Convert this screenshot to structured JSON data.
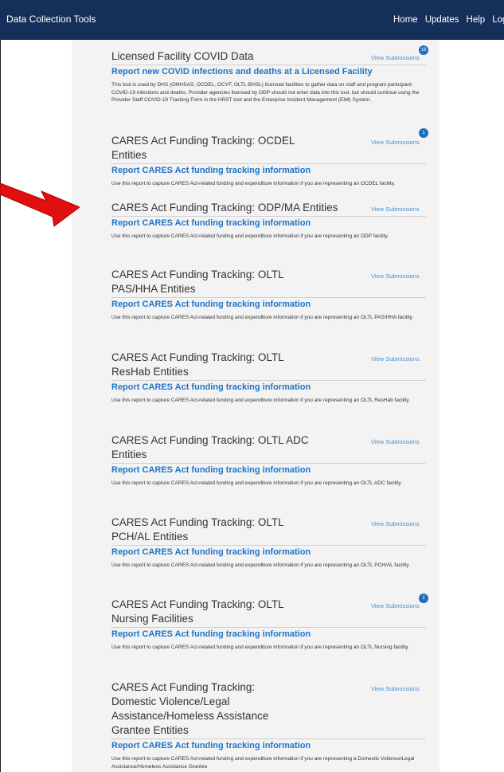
{
  "header": {
    "brand": "Data Collection Tools",
    "nav": [
      "Home",
      "Updates",
      "Help",
      "Logout"
    ]
  },
  "cards": [
    {
      "title": "Licensed Facility COVID Data",
      "view": "View Submissions",
      "badge": "18",
      "link": "Report new COVID infections and deaths at a Licensed Facility",
      "desc": "This tool is used by DHS (OMHSAS, OCDEL, OCYF, OLTL-BHSL) licensed facilities to gather data on staff and program participant COVID-19 infections and deaths. Provider agencies licensed by ODP should not enter data into this tool, but should continue using the Provider Staff COVID-19 Tracking Form in the HRST tool and the Enterprise Incident Management (EIM) System."
    },
    {
      "title": "CARES Act Funding Tracking: OCDEL Entities",
      "view": "View Submissions",
      "badge": "1",
      "link": "Report CARES Act funding tracking information",
      "desc": "Use this report to capture CARES Act-related funding and expenditure information if you are representing an OCDEL facility."
    },
    {
      "title": "CARES Act Funding Tracking: ODP/MA Entities",
      "view": "View Submissions",
      "badge": "",
      "link": "Report CARES Act funding tracking information",
      "desc": "Use this report to capture CARES Act-related funding and expenditure information if you are representing an ODP facility."
    },
    {
      "title": "CARES Act Funding Tracking: OLTL PAS/HHA Entities",
      "view": "View Submissions",
      "badge": "",
      "link": "Report CARES Act funding tracking information",
      "desc": "Use this report to capture CARES Act-related funding and expenditure information if you are representing an OLTL PAS/HHA facility."
    },
    {
      "title": "CARES Act Funding Tracking: OLTL ResHab Entities",
      "view": "View Submissions",
      "badge": "",
      "link": "Report CARES Act funding tracking information",
      "desc": "Use this report to capture CARES Act-related funding and expenditure information if you are representing an OLTL ResHab facility."
    },
    {
      "title": "CARES Act Funding Tracking: OLTL ADC Entities",
      "view": "View Submissions",
      "badge": "",
      "link": "Report CARES Act funding tracking information",
      "desc": "Use this report to capture CARES Act-related funding and expenditure information if you are representing an OLTL ADC facility."
    },
    {
      "title": "CARES Act Funding Tracking: OLTL PCH/AL Entities",
      "view": "View Submissions",
      "badge": "",
      "link": "Report CARES Act funding tracking information",
      "desc": "Use this report to capture CARES Act-related funding and expenditure information if you are representing an OLTL PCH/AL facility."
    },
    {
      "title": "CARES Act Funding Tracking: OLTL Nursing Facilities",
      "view": "View Submissions",
      "badge": "1",
      "link": "Report CARES Act funding tracking information",
      "desc": "Use this report to capture CARES Act-related funding and expenditure information if you are representing an OLTL Nursing facility."
    },
    {
      "title": "CARES Act Funding Tracking: Domestic Violence/Legal Assistance/Homeless Assistance Grantee Entities",
      "view": "View Submissions",
      "badge": "",
      "link": "Report CARES Act funding tracking information",
      "desc": "Use this report to capture CARES Act-related funding and expenditure information if you are representing a Domestic Voilence/Legal Assistance/Homeless Assistance Grantee"
    }
  ],
  "colors": {
    "header": "#14305a",
    "link": "#1f74c7",
    "badge": "#1e6fc0",
    "arrow": "#e01010"
  }
}
